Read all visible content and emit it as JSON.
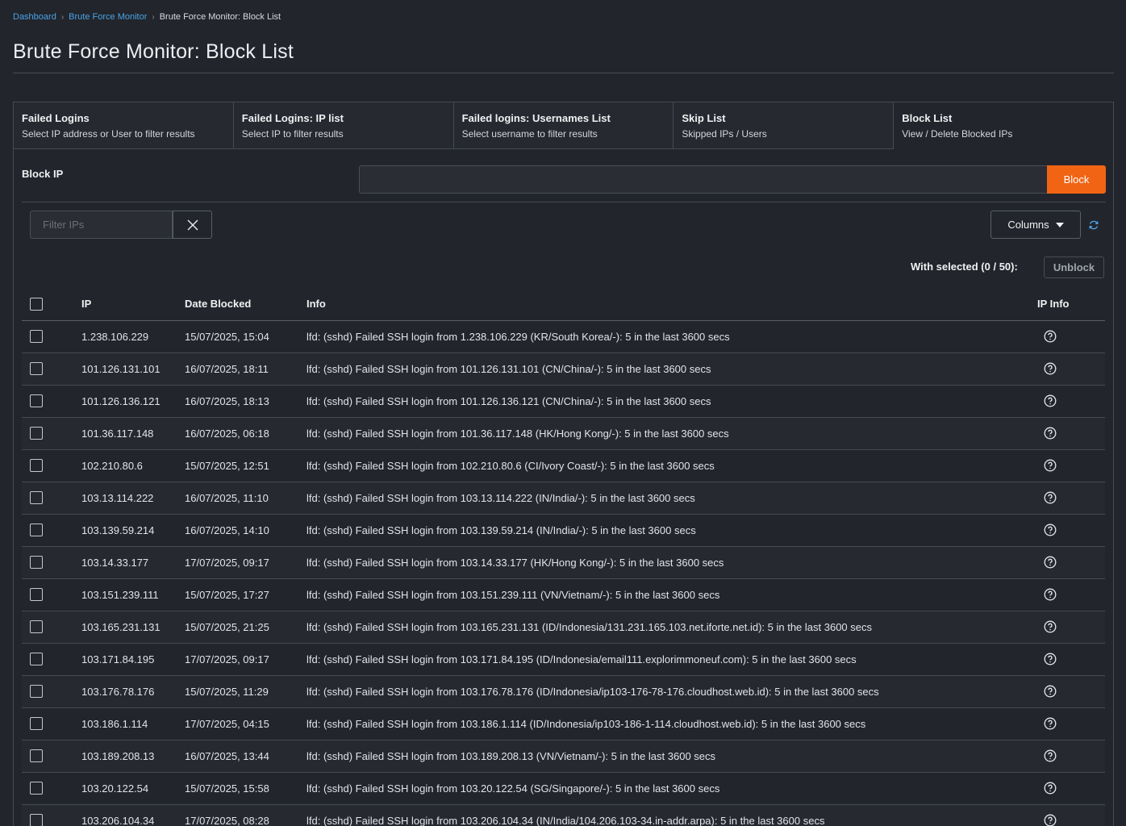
{
  "breadcrumb": {
    "items": [
      "Dashboard",
      "Brute Force Monitor"
    ],
    "current": "Brute Force Monitor: Block List"
  },
  "page_title": "Brute Force Monitor: Block List",
  "tabs": [
    {
      "title": "Failed Logins",
      "subtitle": "Select IP address or User to filter results"
    },
    {
      "title": "Failed Logins: IP list",
      "subtitle": "Select IP to filter results"
    },
    {
      "title": "Failed logins: Usernames List",
      "subtitle": "Select username to filter results"
    },
    {
      "title": "Skip List",
      "subtitle": "Skipped IPs / Users"
    },
    {
      "title": "Block List",
      "subtitle": "View / Delete Blocked IPs"
    }
  ],
  "block_ip": {
    "label": "Block IP",
    "value": "",
    "button": "Block"
  },
  "filter": {
    "placeholder": "Filter IPs"
  },
  "columns_button": "Columns",
  "with_selected": "With selected (0 / 50):",
  "unblock_button": "Unblock",
  "table": {
    "headers": {
      "ip": "IP",
      "date": "Date Blocked",
      "info": "Info",
      "ipinfo": "IP Info"
    },
    "rows": [
      {
        "ip": "1.238.106.229",
        "date": "15/07/2025, 15:04",
        "info": "lfd: (sshd) Failed SSH login from 1.238.106.229 (KR/South Korea/-): 5 in the last 3600 secs"
      },
      {
        "ip": "101.126.131.101",
        "date": "16/07/2025, 18:11",
        "info": "lfd: (sshd) Failed SSH login from 101.126.131.101 (CN/China/-): 5 in the last 3600 secs"
      },
      {
        "ip": "101.126.136.121",
        "date": "16/07/2025, 18:13",
        "info": "lfd: (sshd) Failed SSH login from 101.126.136.121 (CN/China/-): 5 in the last 3600 secs"
      },
      {
        "ip": "101.36.117.148",
        "date": "16/07/2025, 06:18",
        "info": "lfd: (sshd) Failed SSH login from 101.36.117.148 (HK/Hong Kong/-): 5 in the last 3600 secs"
      },
      {
        "ip": "102.210.80.6",
        "date": "15/07/2025, 12:51",
        "info": "lfd: (sshd) Failed SSH login from 102.210.80.6 (CI/Ivory Coast/-): 5 in the last 3600 secs"
      },
      {
        "ip": "103.13.114.222",
        "date": "16/07/2025, 11:10",
        "info": "lfd: (sshd) Failed SSH login from 103.13.114.222 (IN/India/-): 5 in the last 3600 secs"
      },
      {
        "ip": "103.139.59.214",
        "date": "16/07/2025, 14:10",
        "info": "lfd: (sshd) Failed SSH login from 103.139.59.214 (IN/India/-): 5 in the last 3600 secs"
      },
      {
        "ip": "103.14.33.177",
        "date": "17/07/2025, 09:17",
        "info": "lfd: (sshd) Failed SSH login from 103.14.33.177 (HK/Hong Kong/-): 5 in the last 3600 secs"
      },
      {
        "ip": "103.151.239.111",
        "date": "15/07/2025, 17:27",
        "info": "lfd: (sshd) Failed SSH login from 103.151.239.111 (VN/Vietnam/-): 5 in the last 3600 secs"
      },
      {
        "ip": "103.165.231.131",
        "date": "15/07/2025, 21:25",
        "info": "lfd: (sshd) Failed SSH login from 103.165.231.131 (ID/Indonesia/131.231.165.103.net.iforte.net.id): 5 in the last 3600 secs"
      },
      {
        "ip": "103.171.84.195",
        "date": "17/07/2025, 09:17",
        "info": "lfd: (sshd) Failed SSH login from 103.171.84.195 (ID/Indonesia/email111.explorimmoneuf.com): 5 in the last 3600 secs"
      },
      {
        "ip": "103.176.78.176",
        "date": "15/07/2025, 11:29",
        "info": "lfd: (sshd) Failed SSH login from 103.176.78.176 (ID/Indonesia/ip103-176-78-176.cloudhost.web.id): 5 in the last 3600 secs"
      },
      {
        "ip": "103.186.1.114",
        "date": "17/07/2025, 04:15",
        "info": "lfd: (sshd) Failed SSH login from 103.186.1.114 (ID/Indonesia/ip103-186-1-114.cloudhost.web.id): 5 in the last 3600 secs"
      },
      {
        "ip": "103.189.208.13",
        "date": "16/07/2025, 13:44",
        "info": "lfd: (sshd) Failed SSH login from 103.189.208.13 (VN/Vietnam/-): 5 in the last 3600 secs"
      },
      {
        "ip": "103.20.122.54",
        "date": "15/07/2025, 15:58",
        "info": "lfd: (sshd) Failed SSH login from 103.20.122.54 (SG/Singapore/-): 5 in the last 3600 secs"
      },
      {
        "ip": "103.206.104.34",
        "date": "17/07/2025, 08:28",
        "info": "lfd: (sshd) Failed SSH login from 103.206.104.34 (IN/India/104.206.103-34.in-addr.arpa): 5 in the last 3600 secs"
      }
    ]
  },
  "colors": {
    "accent": "#f06414",
    "link": "#4aa3e8",
    "background": "#22252b"
  },
  "icons": {
    "clear": "x-icon",
    "dropdown": "caret-down-icon",
    "refresh": "refresh-icon",
    "ipinfo": "question-circle-icon",
    "breadcrumb_sep": "chevron-right-icon"
  }
}
